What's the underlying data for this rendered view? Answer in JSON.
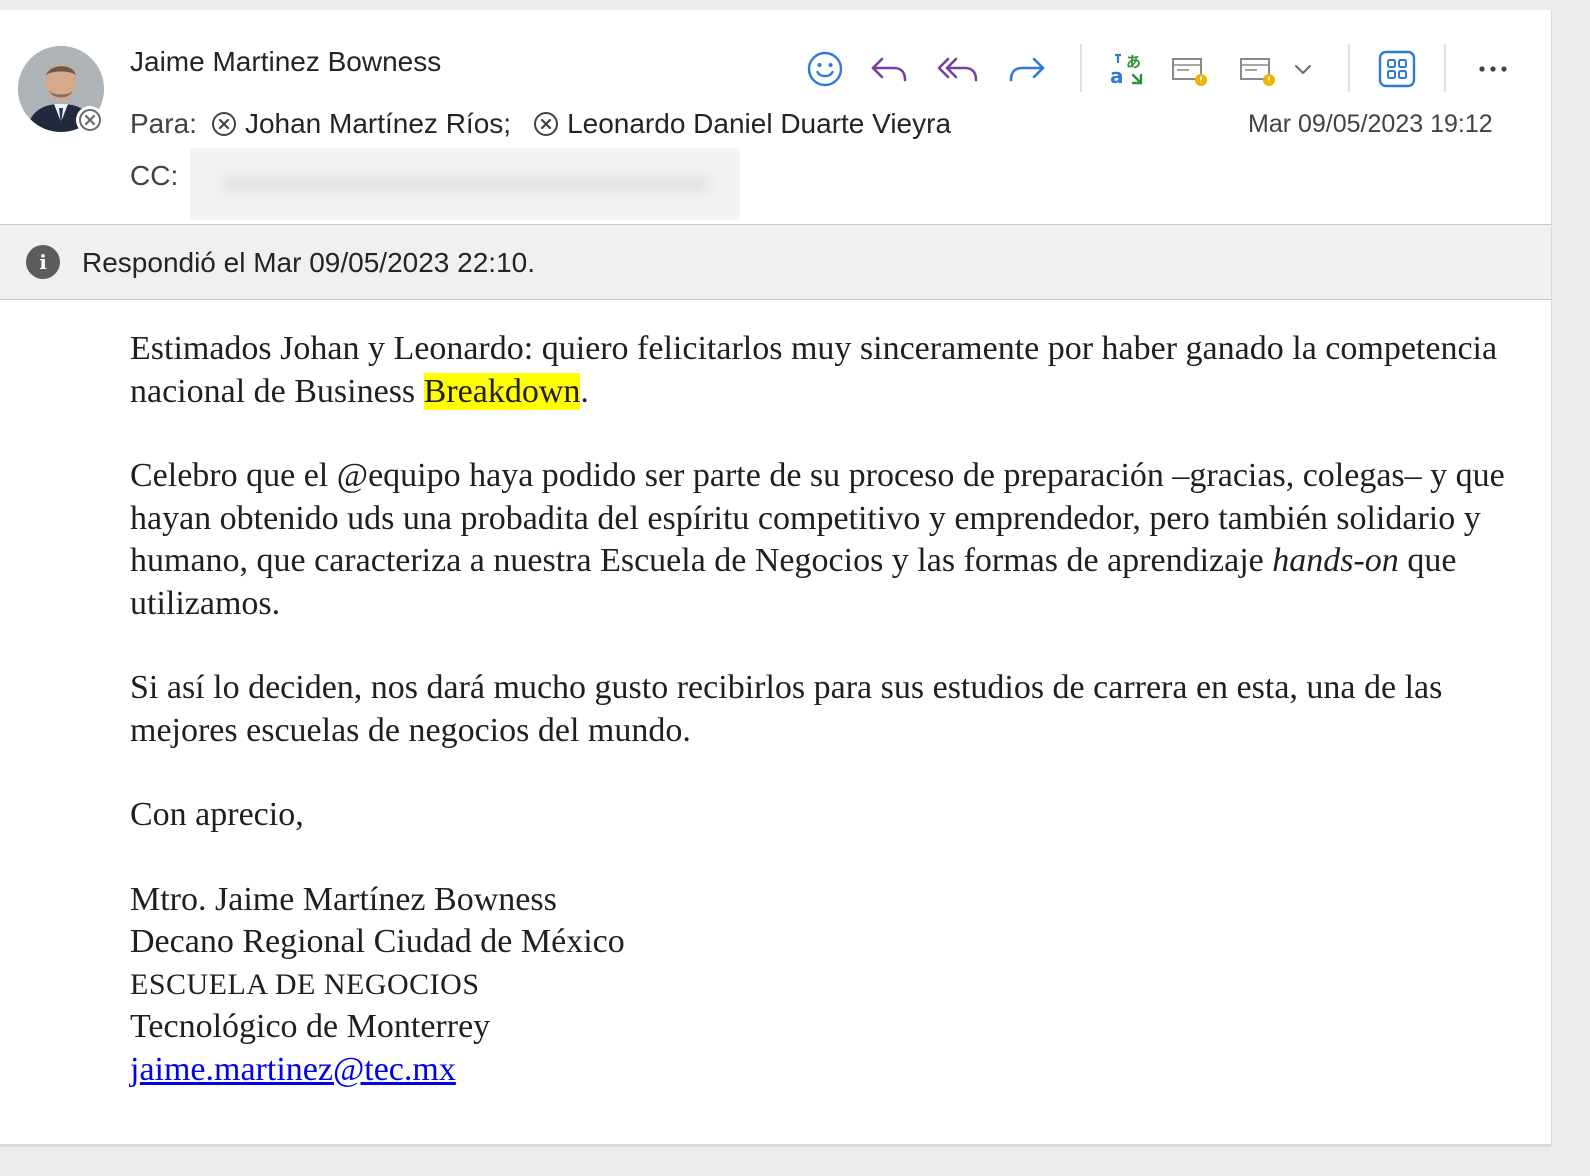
{
  "header": {
    "sender_name": "Jaime Martinez Bowness",
    "to_label": "Para:",
    "recipients": [
      "Johan Martínez Ríos;",
      "Leonardo Daniel Duarte Vieyra"
    ],
    "cc_label": "CC:",
    "datetime": "Mar 09/05/2023 19:12"
  },
  "toolbar": {
    "icons": [
      "smiley-icon",
      "reply-icon",
      "reply-all-icon",
      "forward-icon",
      "translate-icon",
      "report-icon",
      "report-dropdown-icon",
      "chevron-down-icon",
      "apps-icon",
      "more-icon"
    ]
  },
  "infobar": {
    "text": "Respondió el Mar 09/05/2023 22:10."
  },
  "body": {
    "p1_before": "Estimados Johan y Leonardo: quiero felicitarlos muy sinceramente por haber ganado la competencia nacional de Business ",
    "p1_highlight": "Breakdown",
    "p1_after": ".",
    "p2_before": "Celebro que el @equipo haya podido ser parte de su proceso de preparación –gracias, colegas– y que hayan obtenido uds una probadita del espíritu competitivo y emprendedor, pero también solidario y humano, que caracteriza a nuestra Escuela de Negocios y las formas de aprendizaje ",
    "p2_italic": "hands-on",
    "p2_after": " que utilizamos.",
    "p3": "Si así lo deciden, nos dará mucho gusto recibirlos para sus estudios de carrera en esta, una de las mejores escuelas de negocios del mundo.",
    "closing": "Con aprecio,",
    "sig_name": "Mtro. Jaime Martínez Bowness",
    "sig_title": "Decano Regional Ciudad de México",
    "sig_school": "ESCUELA DE NEGOCIOS",
    "sig_org": "Tecnológico de Monterrey",
    "sig_email": "jaime.martinez@tec.mx"
  },
  "colors": {
    "reply_purple": "#7a3f9e",
    "forward_blue": "#2f7ad6",
    "highlight": "#ffff00",
    "link": "#0000ee"
  }
}
